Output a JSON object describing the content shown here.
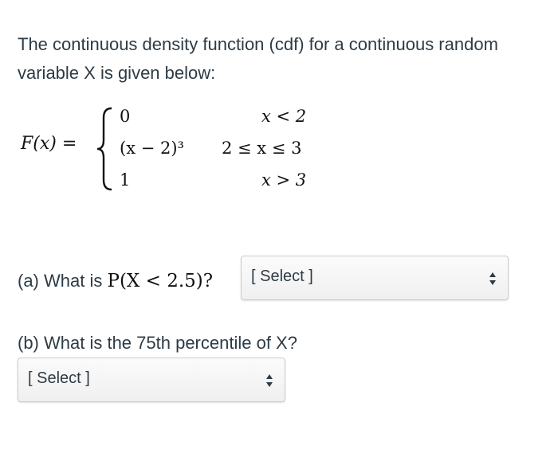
{
  "intro": "The continuous density function (cdf) for a continuous random variable X is given below:",
  "cdf": {
    "lhs": "F(x) =",
    "cases": [
      {
        "value": "0",
        "condition": "x < 2"
      },
      {
        "value": "(x − 2)³",
        "condition": "2 ≤ x ≤ 3"
      },
      {
        "value": "1",
        "condition": "x > 3"
      }
    ]
  },
  "question_a": {
    "prefix": "(a) What is",
    "math": "P(X < 2.5)?",
    "select_value": "[ Select ]"
  },
  "question_b": {
    "text": "(b) What is the 75th percentile of X?",
    "select_value": "[ Select ]"
  },
  "icons": {
    "select_arrows": "up-down-arrows-icon"
  }
}
